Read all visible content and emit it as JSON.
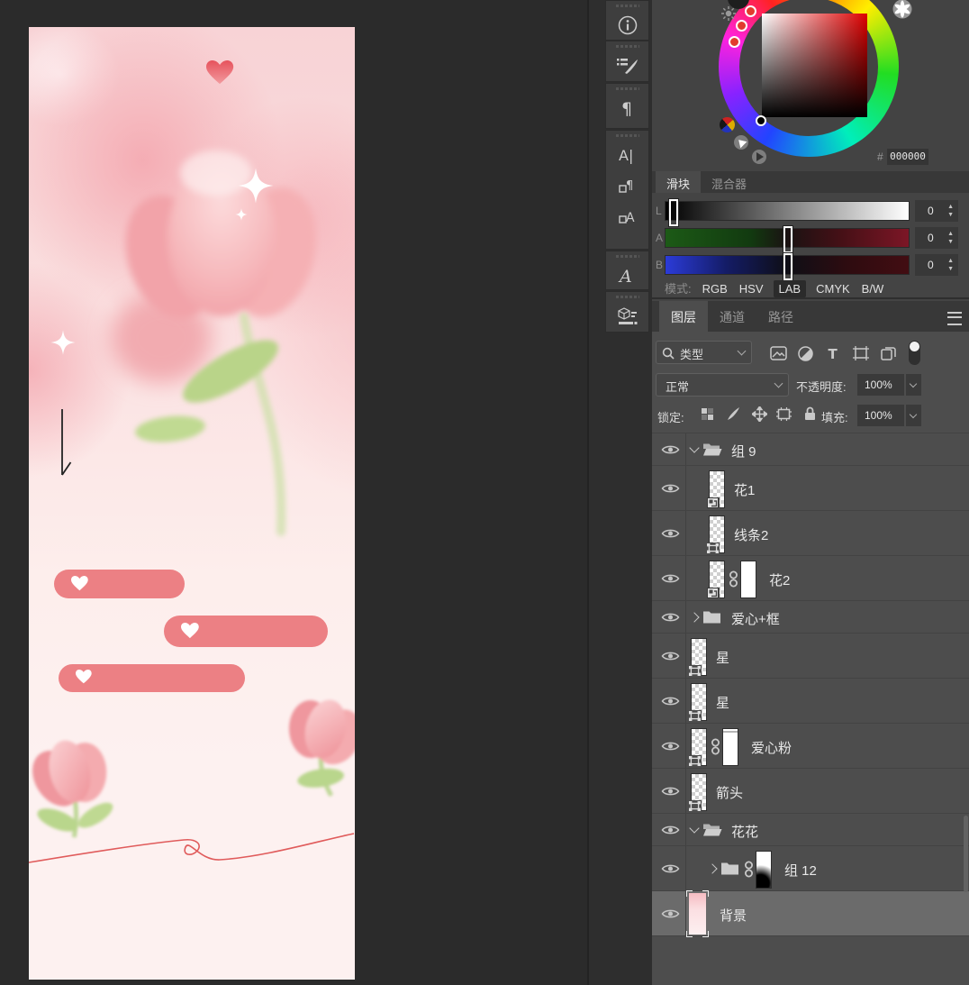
{
  "canvas": {
    "description": "pink tulip illustration poster",
    "colors": {
      "background_pink": "#fbe3e5",
      "bubble": "#ec8084",
      "heart": "#e6525c",
      "leaf": "#bdd88e",
      "squiggle_line": "#e05b5b",
      "arrow": "#242424"
    }
  },
  "dock": {
    "groups": [
      {
        "icons": [
          "info-icon"
        ]
      },
      {
        "icons": [
          "brush-settings-icon"
        ]
      },
      {
        "icons": [
          "paragraph-icon"
        ]
      },
      {
        "icons": [
          "character-icon",
          "paragraph-styles-icon",
          "character-styles-icon"
        ]
      },
      {
        "icons": [
          "glyphs-icon"
        ]
      },
      {
        "icons": [
          "3d-icon"
        ]
      }
    ]
  },
  "picker": {
    "hex_label": "#",
    "hex_value": "000000"
  },
  "slider_panel": {
    "tabs": [
      {
        "label": "滑块",
        "active": true
      },
      {
        "label": "混合器",
        "active": false
      }
    ],
    "sliders": [
      {
        "label": "L",
        "value": "0",
        "gradient": "l",
        "handle": 0.015
      },
      {
        "label": "A",
        "value": "0",
        "gradient": "a",
        "handle": 0.5
      },
      {
        "label": "B",
        "value": "0",
        "gradient": "b",
        "handle": 0.5
      }
    ],
    "mode_label": "模式:",
    "modes": [
      {
        "label": "RGB"
      },
      {
        "label": "HSV"
      },
      {
        "label": "LAB",
        "active": true
      },
      {
        "label": "CMYK"
      },
      {
        "label": "B/W"
      }
    ]
  },
  "layers_panel": {
    "tabs": [
      {
        "label": "图层",
        "active": true
      },
      {
        "label": "通道"
      },
      {
        "label": "路径"
      }
    ],
    "filter": {
      "search_label": "类型",
      "buttons": [
        "image-filter-icon",
        "adjustment-filter-icon",
        "type-filter-icon",
        "frame-filter-icon",
        "smart-object-filter-icon"
      ]
    },
    "blend_mode": "正常",
    "opacity_label": "不透明度:",
    "opacity_value": "100%",
    "lock_label": "锁定:",
    "lock_buttons": [
      "lock-transparency-icon",
      "lock-paint-icon",
      "lock-move-icon",
      "lock-artboard-icon",
      "lock-all-icon"
    ],
    "fill_label": "填充:",
    "fill_value": "100%",
    "layers": [
      {
        "name": "组 9",
        "kind": "group",
        "expanded": true,
        "indent": 0
      },
      {
        "name": "花1",
        "kind": "layer",
        "indent": 1,
        "badge": "smart"
      },
      {
        "name": "线条2",
        "kind": "layer",
        "indent": 1,
        "badge": "vector"
      },
      {
        "name": "花2",
        "kind": "layer",
        "indent": 1,
        "badge": "smart",
        "link": true,
        "mask": "white"
      },
      {
        "name": "爱心+框",
        "kind": "group",
        "expanded": false,
        "indent": 0
      },
      {
        "name": "星",
        "kind": "layer",
        "indent": 0,
        "badge": "vector"
      },
      {
        "name": "星",
        "kind": "layer",
        "indent": 0,
        "badge": "vector"
      },
      {
        "name": "爱心粉",
        "kind": "layer",
        "indent": 0,
        "badge": "vector",
        "link": true,
        "mask": "white-top"
      },
      {
        "name": "箭头",
        "kind": "layer",
        "indent": 0,
        "badge": "vector"
      },
      {
        "name": "花花",
        "kind": "group",
        "expanded": true,
        "indent": 0
      },
      {
        "name": "组 12",
        "kind": "group",
        "expanded": false,
        "indent": 1,
        "link": true,
        "mask": "blob",
        "tall": true
      },
      {
        "name": "背景",
        "kind": "layer",
        "indent": 0,
        "thumb": "background",
        "selected": true
      }
    ]
  }
}
